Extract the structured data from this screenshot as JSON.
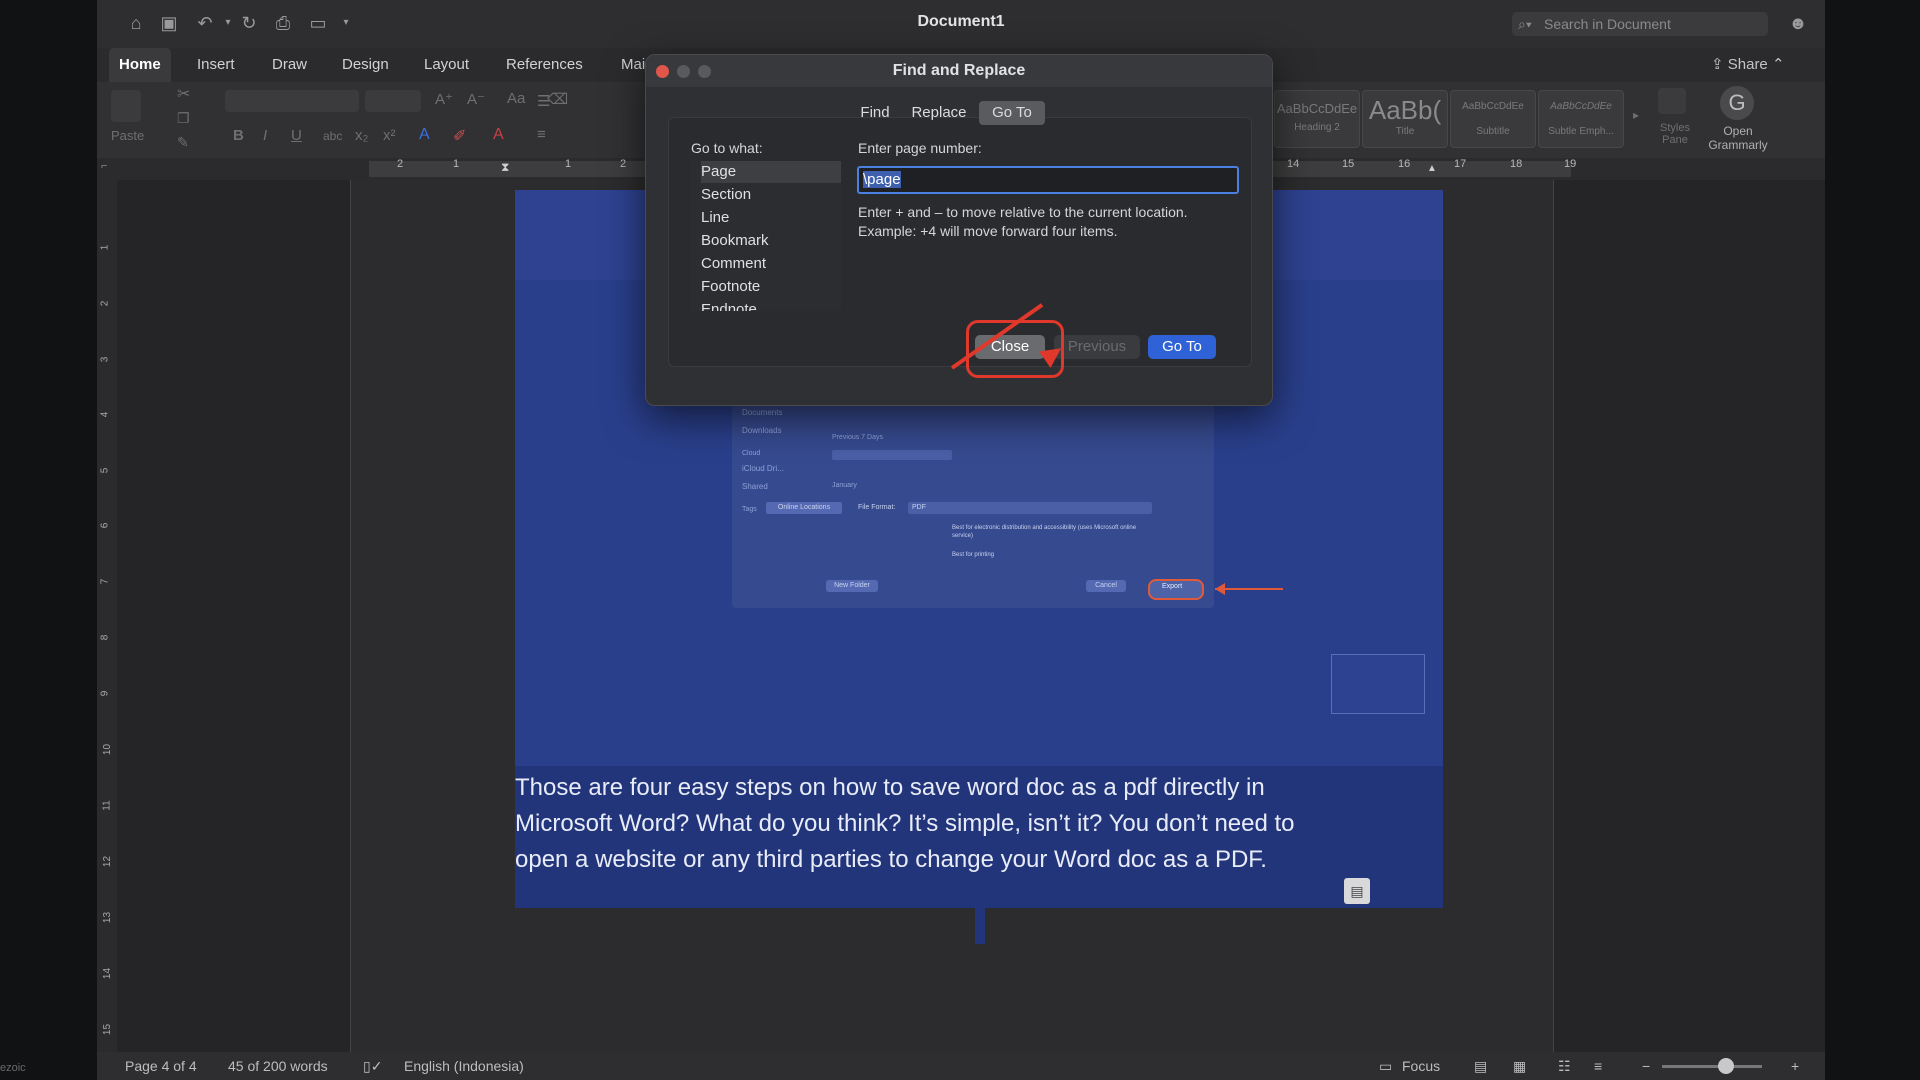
{
  "window": {
    "title": "Document1",
    "search_placeholder": "Search in Document",
    "share_label": "Share"
  },
  "ribbon_tabs": [
    "Home",
    "Insert",
    "Draw",
    "Design",
    "Layout",
    "References",
    "Mai"
  ],
  "ribbon": {
    "paste_label": "Paste",
    "style_cards": [
      {
        "preview": "AaBbCcDdEe",
        "label": "Heading 2"
      },
      {
        "preview": "AaBb(",
        "label": "Title"
      },
      {
        "preview": "AaBbCcDdEe",
        "label": "Subtitle"
      },
      {
        "preview": "AaBbCcDdEe",
        "label": "Subtle Emph..."
      }
    ],
    "styles_pane_label": "Styles Pane",
    "grammarly_label": "Open Grammarly"
  },
  "ruler": {
    "left_numbers": [
      "2",
      "1",
      "1",
      "2"
    ],
    "right_numbers": [
      "14",
      "15",
      "16",
      "17",
      "18",
      "19"
    ]
  },
  "vertical_ruler": [
    "1",
    "2",
    "3",
    "4",
    "5",
    "6",
    "7",
    "8",
    "9",
    "10",
    "11",
    "12",
    "13",
    "14",
    "15"
  ],
  "dialog": {
    "title": "Find and Replace",
    "tabs": [
      "Find",
      "Replace",
      "Go To"
    ],
    "active_tab": "Go To",
    "go_to_what_label": "Go to what:",
    "go_to_items": [
      "Page",
      "Section",
      "Line",
      "Bookmark",
      "Comment",
      "Footnote",
      "Endnote"
    ],
    "selected_item": "Page",
    "enter_label": "Enter page number:",
    "input_value": "\\page",
    "help_text": "Enter + and – to move relative to the current location. Example: +4 will move forward four items.",
    "buttons": {
      "close": "Close",
      "previous": "Previous",
      "goto": "Go To"
    }
  },
  "embedded_screenshot": {
    "sidebar": [
      "Documents",
      "Downloads",
      "Cloud",
      "iCloud Dri...",
      "Shared",
      "Tags"
    ],
    "recent_label": "Previous 7 Days",
    "month_label": "January",
    "online_locations": "Online Locations",
    "file_format_label": "File Format:",
    "file_format_value": "PDF",
    "option_1": "Best for electronic distribution and accessibility (uses Microsoft online service)",
    "option_2": "Best for printing",
    "new_folder": "New Folder",
    "cancel": "Cancel",
    "export": "Export"
  },
  "paragraph_lines": [
    "Those are four easy steps on how to save word doc as a pdf directly in",
    "Microsoft Word? What do you think? It’s simple, isn’t it? You don’t need to",
    "open a website or any third parties to change your Word doc as a PDF."
  ],
  "status_bar": {
    "page": "Page 4 of 4",
    "words": "45 of 200 words",
    "language": "English (Indonesia)",
    "focus": "Focus"
  },
  "corner_watermark": "ezoic",
  "colors": {
    "accent_blue": "#2f62d6",
    "highlight_red": "#e0382a",
    "selection_blue": "#23357a"
  }
}
